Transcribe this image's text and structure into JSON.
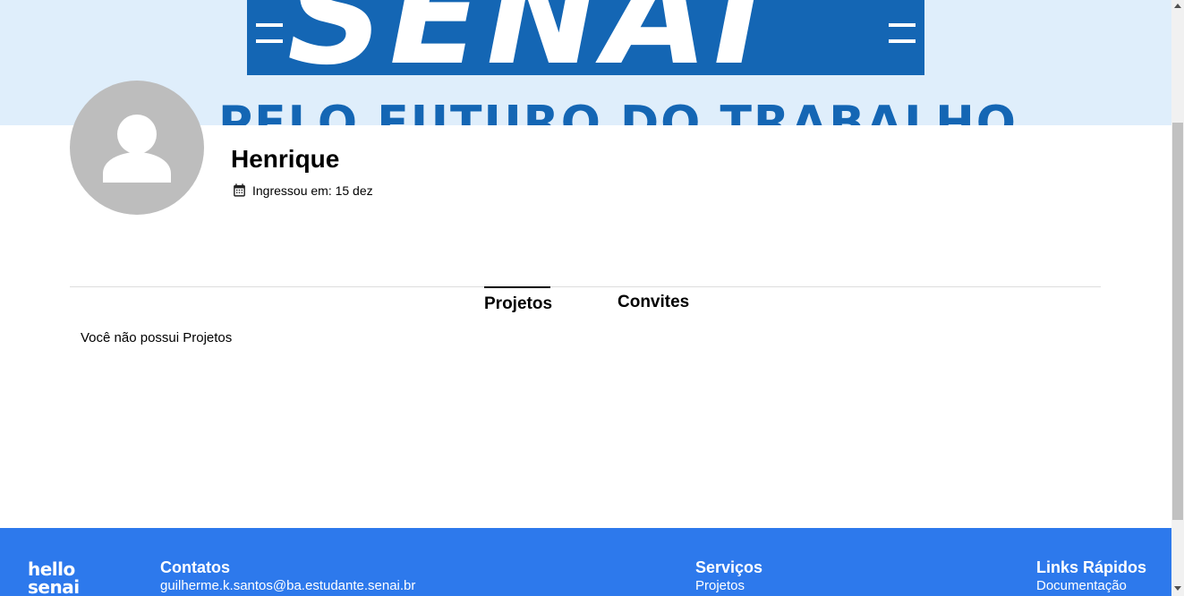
{
  "banner": {
    "logo_text": "SENAI",
    "tagline": "PELO FUTURO DO TRABALHO",
    "brand_color": "#1466b4",
    "background_color": "#dfeefb"
  },
  "profile": {
    "avatar_icon": "person-icon",
    "name": "Henrique",
    "joined_icon": "calendar-icon",
    "joined_label": "Ingressou em: 15 dez"
  },
  "tabs": [
    {
      "label": "Projetos",
      "active": true
    },
    {
      "label": "Convites",
      "active": false
    }
  ],
  "projects": {
    "empty_message": "Você não possui Projetos"
  },
  "footer": {
    "background_color": "#2d79ec",
    "logo_line1": "hello",
    "logo_line2": "senai",
    "contatos": {
      "title": "Contatos",
      "items": [
        "guilherme.k.santos@ba.estudante.senai.br"
      ]
    },
    "servicos": {
      "title": "Serviços",
      "items": [
        "Projetos"
      ]
    },
    "links_rapidos": {
      "title": "Links Rápidos",
      "items": [
        "Documentação"
      ]
    }
  }
}
